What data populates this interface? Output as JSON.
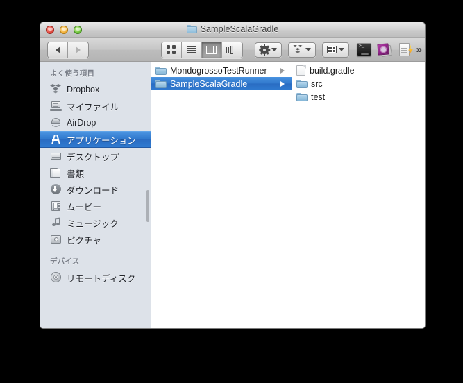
{
  "window": {
    "title": "SampleScalaGradle",
    "title_icon": "folder-icon",
    "traffic_lights": {
      "close_label": "close",
      "minimize_label": "minimize",
      "zoom_label": "zoom"
    }
  },
  "toolbar": {
    "back_label": "Back",
    "forward_label": "Forward",
    "view_modes": [
      {
        "name": "icon-view",
        "active": false
      },
      {
        "name": "list-view",
        "active": false
      },
      {
        "name": "column-view",
        "active": true
      },
      {
        "name": "coverflow-view",
        "active": false
      }
    ],
    "action_menu_label": "Action",
    "dropbox_label": "Dropbox",
    "arrange_label": "Arrange",
    "terminal_label": "Terminal",
    "photo_app_label": "Photo App",
    "doc_lightning_label": "Quick Document",
    "overflow_label": "»"
  },
  "sidebar": {
    "sections": [
      {
        "header": "よく使う項目",
        "items": [
          {
            "label": "Dropbox",
            "icon": "dropbox-icon",
            "selected": false
          },
          {
            "label": "マイファイル",
            "icon": "my-files-icon",
            "selected": false
          },
          {
            "label": "AirDrop",
            "icon": "airdrop-icon",
            "selected": false
          },
          {
            "label": "アプリケーション",
            "icon": "applications-icon",
            "selected": true
          },
          {
            "label": "デスクトップ",
            "icon": "desktop-icon",
            "selected": false
          },
          {
            "label": "書類",
            "icon": "documents-icon",
            "selected": false
          },
          {
            "label": "ダウンロード",
            "icon": "downloads-icon",
            "selected": false
          },
          {
            "label": "ムービー",
            "icon": "movies-icon",
            "selected": false
          },
          {
            "label": "ミュージック",
            "icon": "music-icon",
            "selected": false
          },
          {
            "label": "ピクチャ",
            "icon": "pictures-icon",
            "selected": false
          }
        ]
      },
      {
        "header": "デバイス",
        "items": [
          {
            "label": "リモートディスク",
            "icon": "remote-disk-icon",
            "selected": false
          }
        ]
      }
    ]
  },
  "columns": [
    {
      "name": "column-1",
      "rows": [
        {
          "label": "MondogrossoTestRunner",
          "type": "folder",
          "selected": false,
          "has_children": true
        },
        {
          "label": "SampleScalaGradle",
          "type": "folder",
          "selected": true,
          "has_children": true
        }
      ]
    },
    {
      "name": "column-2",
      "rows": [
        {
          "label": "build.gradle",
          "type": "file",
          "selected": false,
          "has_children": false
        },
        {
          "label": "src",
          "type": "folder",
          "selected": false,
          "has_children": false
        },
        {
          "label": "test",
          "type": "folder",
          "selected": false,
          "has_children": false
        }
      ]
    }
  ],
  "colors": {
    "selection_blue": "#2f77cc",
    "sidebar_bg": "#dde2e9",
    "titlebar_gray": "#cbcbcb",
    "folder_blue": "#9cc6e2",
    "desktop_black": "#000000"
  }
}
